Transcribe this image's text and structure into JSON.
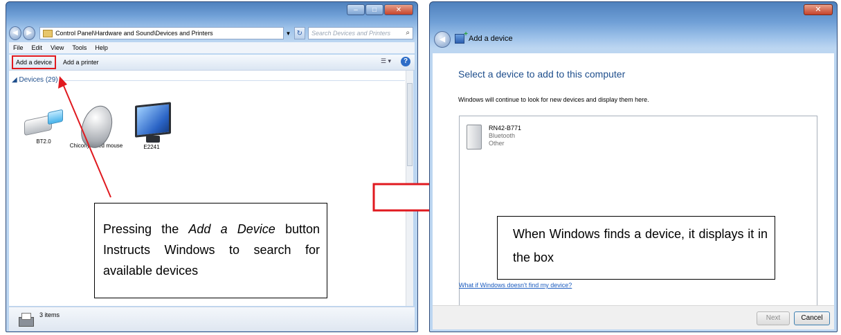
{
  "left_window": {
    "address": "Control Panel\\Hardware and Sound\\Devices and Printers",
    "search_placeholder": "Search Devices and Printers",
    "menu": [
      "File",
      "Edit",
      "View",
      "Tools",
      "Help"
    ],
    "toolbar": {
      "add_device": "Add a device",
      "add_printer": "Add a printer"
    },
    "group_header": "Devices (29)",
    "devices": [
      {
        "label": "BT2.0",
        "icon": "usb-dongle-icon"
      },
      {
        "label": "Chicony wired mouse",
        "icon": "mouse-icon"
      },
      {
        "label": "E2241",
        "icon": "monitor-icon"
      }
    ],
    "status": "3 items"
  },
  "callout_left": {
    "line1a": "Pressing the ",
    "line1i": "Add a Device",
    "line1b": " button",
    "rest": "Instructs Windows to search for available devices"
  },
  "right_window": {
    "title": "Add a device",
    "heading": "Select a device to add to this computer",
    "subtitle": "Windows will continue to look for new devices and display them here.",
    "found_device": {
      "name": "RN42-B771",
      "type": "Bluetooth",
      "category": "Other"
    },
    "help_link": "What if Windows doesn't find my device?",
    "next_label": "Next",
    "cancel_label": "Cancel"
  },
  "callout_right": "When Windows finds a device, it displays it in the box",
  "colors": {
    "annotation_red": "#e0191f",
    "link_blue": "#1a5bbf",
    "heading_blue": "#1e4e8c"
  }
}
